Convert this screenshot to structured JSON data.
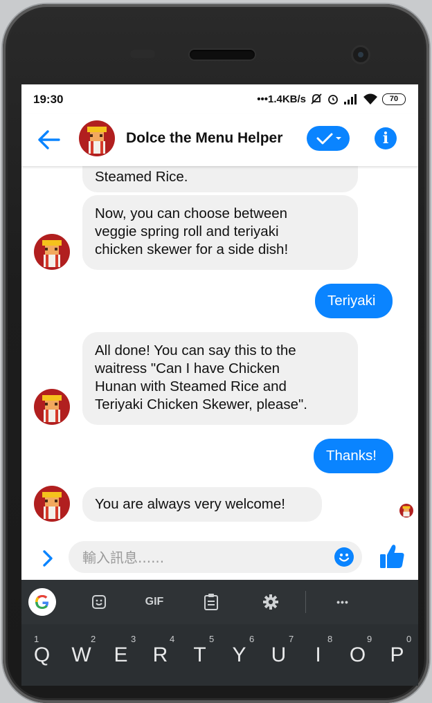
{
  "status": {
    "time": "19:30",
    "speed": "•••1.4KB/s",
    "battery": "70"
  },
  "header": {
    "title": "Dolce the Menu Helper",
    "info_glyph": "i"
  },
  "messages": [
    {
      "from": "bot",
      "text": "Steamed Rice."
    },
    {
      "from": "bot",
      "text": "Now, you can choose between veggie spring roll and teriyaki chicken skewer for a side dish!"
    },
    {
      "from": "user",
      "text": "Teriyaki"
    },
    {
      "from": "bot",
      "text": "All done! You can say this to the waitress \"Can I have Chicken Hunan with Steamed Rice and Teriyaki Chicken Skewer, please\"."
    },
    {
      "from": "user",
      "text": "Thanks!"
    },
    {
      "from": "bot",
      "text": "You are always very welcome!"
    }
  ],
  "message_lines": {
    "m0": [
      "Steamed Rice."
    ],
    "m1": [
      "Now, you can choose between",
      "veggie spring roll and teriyaki",
      "chicken skewer for a side dish!"
    ],
    "m3": [
      "All done! You can say this to the",
      "waitress \"Can I have Chicken",
      "Hunan with Steamed Rice and",
      "Teriyaki Chicken Skewer, please\"."
    ]
  },
  "composer": {
    "placeholder": "輸入訊息......"
  },
  "keyboard": {
    "toolbar": {
      "gif": "GIF",
      "more": "•••"
    },
    "row1": [
      {
        "key": "Q",
        "num": "1"
      },
      {
        "key": "W",
        "num": "2"
      },
      {
        "key": "E",
        "num": "3"
      },
      {
        "key": "R",
        "num": "4"
      },
      {
        "key": "T",
        "num": "5"
      },
      {
        "key": "Y",
        "num": "6"
      },
      {
        "key": "U",
        "num": "7"
      },
      {
        "key": "I",
        "num": "8"
      },
      {
        "key": "O",
        "num": "9"
      },
      {
        "key": "P",
        "num": "0"
      }
    ]
  },
  "colors": {
    "accent": "#0a84ff",
    "bot_bubble": "#f0f0f0",
    "keyboard_bg": "#2b2f32"
  }
}
